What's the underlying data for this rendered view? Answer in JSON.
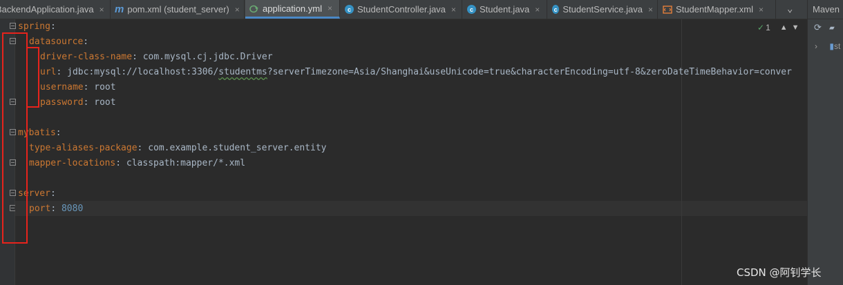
{
  "tabs": [
    {
      "label": "BackendApplication.java",
      "icon": "class-icon"
    },
    {
      "label": "pom.xml (student_server)",
      "icon": "maven-icon"
    },
    {
      "label": "application.yml",
      "icon": "yaml-icon",
      "active": true
    },
    {
      "label": "StudentController.java",
      "icon": "class-icon"
    },
    {
      "label": "Student.java",
      "icon": "class-icon"
    },
    {
      "label": "StudentService.java",
      "icon": "class-icon"
    },
    {
      "label": "StudentMapper.xml",
      "icon": "xml-icon"
    }
  ],
  "tab_close_glyph": "×",
  "maven_panel": {
    "title": "Maven",
    "tree_node": "st"
  },
  "inspection": {
    "count": "1"
  },
  "code": {
    "l1": {
      "key": "spring",
      "sep": ":"
    },
    "l2": {
      "key": "datasource",
      "sep": ":"
    },
    "l3": {
      "key": "driver-class-name",
      "sep": ": ",
      "value": "com.mysql.cj.jdbc.Driver"
    },
    "l4": {
      "key": "url",
      "sep": ": ",
      "value_a": "jdbc:mysql://localhost:3306/",
      "value_b": "studentms",
      "value_c": "?serverTimezone=Asia/Shanghai&useUnicode=true&characterEncoding=utf-8&zeroDateTimeBehavior=conver"
    },
    "l5": {
      "key": "username",
      "sep": ": ",
      "value": "root"
    },
    "l6": {
      "key": "password",
      "sep": ": ",
      "value": "root"
    },
    "l8": {
      "key": "mybatis",
      "sep": ":"
    },
    "l9": {
      "key": "type-aliases-package",
      "sep": ": ",
      "value": "com.example.student_server.entity"
    },
    "l10": {
      "key": "mapper-locations",
      "sep": ": ",
      "value": "classpath:mapper/*.xml"
    },
    "l12": {
      "key": "server",
      "sep": ":"
    },
    "l13": {
      "key": "port",
      "sep": ": ",
      "value": "8080"
    }
  },
  "watermark": "CSDN @阿钊学长",
  "colors": {
    "keyword": "#cc7832",
    "number": "#6897bb",
    "text": "#a9b7c6",
    "annotation": "#e8231c",
    "background": "#2b2b2b"
  }
}
